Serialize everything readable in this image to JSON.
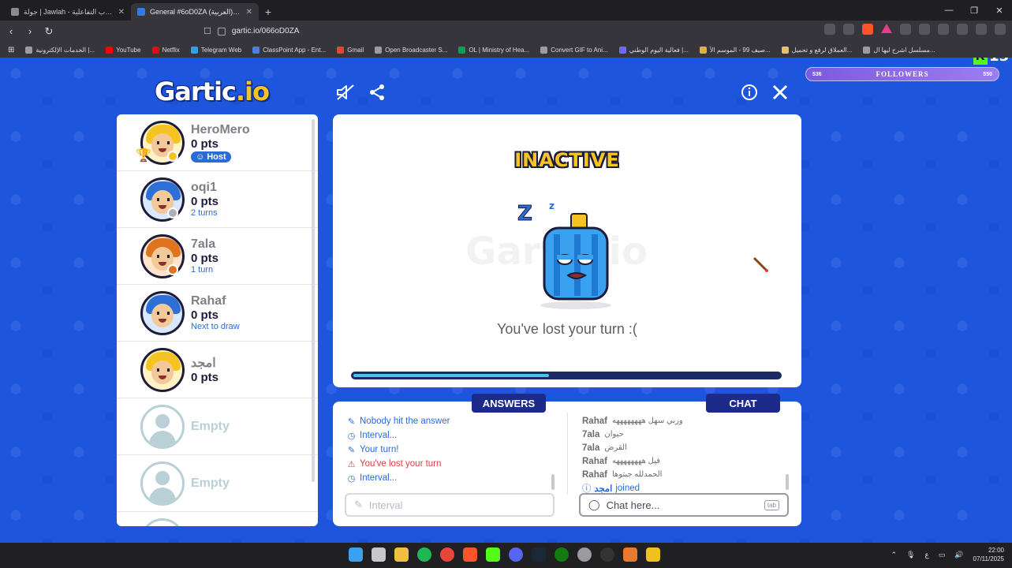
{
  "browser": {
    "tabs": [
      {
        "title": "جولة | Jawlah - منصة الألعاب التفاعلية",
        "active": false
      },
      {
        "title": "General #6oD0ZA (العربية) - Gartic",
        "active": true
      }
    ],
    "url": "gartic.io/066oD0ZA",
    "bookmarks": [
      "الخدمات الإلكترونية |...",
      "YouTube",
      "Netflix",
      "Telegram Web",
      "ClassPoint App - Ent...",
      "Gmail",
      "Open Broadcaster S...",
      "OL | Ministry of Hea...",
      "Convert GIF to Ani...",
      "فعالية اليوم الوطني |...",
      "صيف 99 - الموسم الأ...",
      "العملاق لرفع و تحميل...",
      "مسلسل اشرح ليها ال..."
    ]
  },
  "overlay": {
    "followers_label": "FOLLOWERS",
    "followers_current": "536",
    "followers_goal": "550",
    "kick_count": "15"
  },
  "game": {
    "logo_main": "Gartic",
    "logo_suffix": ".io",
    "status_title": "INACTIVE",
    "status_message": "You've lost your turn :(",
    "turn_progress": 0.46
  },
  "players": [
    {
      "name": "HeroMero",
      "points": "0 pts",
      "host_label": "Host",
      "sub": "",
      "dot_color": "#f6c324",
      "hair_color": "#f6c324",
      "is_host": true
    },
    {
      "name": "oqi1",
      "points": "0 pts",
      "sub": "2 turns",
      "dot_color": "#b0b0b8",
      "hair_color": "#2e6fd6"
    },
    {
      "name": "7ala",
      "points": "0 pts",
      "sub": "1 turn",
      "dot_color": "#e0741e",
      "hair_color": "#e0741e"
    },
    {
      "name": "Rahaf",
      "points": "0 pts",
      "sub": "Next to draw",
      "dot_color": "",
      "hair_color": "#2e6fd6"
    },
    {
      "name": "امجد",
      "points": "0 pts",
      "sub": "",
      "dot_color": "",
      "hair_color": "#f6c324"
    }
  ],
  "empty_slots": [
    "Empty",
    "Empty"
  ],
  "answers": {
    "title": "ANSWERS",
    "items": [
      {
        "icon": "pencil",
        "text": "Nobody hit the answer",
        "type": "info"
      },
      {
        "icon": "clock",
        "text": "Interval...",
        "type": "info"
      },
      {
        "icon": "pencil",
        "text": "Your turn!",
        "type": "info"
      },
      {
        "icon": "warning",
        "text": "You've lost your turn",
        "type": "error"
      },
      {
        "icon": "clock",
        "text": "Interval...",
        "type": "info"
      }
    ],
    "input_placeholder": "Interval"
  },
  "chat": {
    "title": "CHAT",
    "messages": [
      {
        "name": "Rahaf",
        "text": "وربي سهل ههههههههه"
      },
      {
        "name": "7ala",
        "text": "حيوان"
      },
      {
        "name": "7ala",
        "text": "القرض"
      },
      {
        "name": "Rahaf",
        "text": "فيل ههههههههه"
      },
      {
        "name": "Rahaf",
        "text": "الحمدلله جبتوها"
      }
    ],
    "join_name": "امجد",
    "join_text": "joined",
    "input_placeholder": "Chat here...",
    "tab_hint": "tab"
  },
  "taskbar": {
    "time": "22:00",
    "date": "07/11/2025",
    "lang": "ع"
  },
  "colors": {
    "page_bg": "#1d55dd",
    "accent_blue": "#2a6bd8",
    "panel_title": "#1c2a8a",
    "error_red": "#e23b3b",
    "gold": "#f6c324"
  }
}
